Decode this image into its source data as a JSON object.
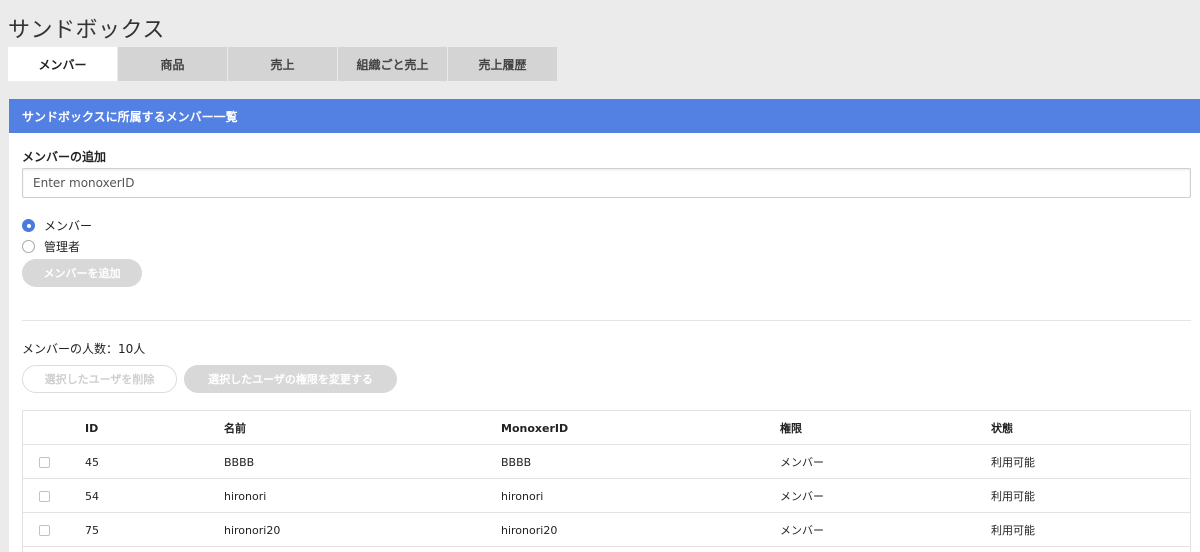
{
  "app": {
    "title": "サンドボックス"
  },
  "tabs": [
    {
      "label": "メンバー",
      "active": true
    },
    {
      "label": "商品",
      "active": false
    },
    {
      "label": "売上",
      "active": false
    },
    {
      "label": "組織ごと売上",
      "active": false
    },
    {
      "label": "売上履歴",
      "active": false
    }
  ],
  "panel": {
    "header": "サンドボックスに所属するメンバー一覧",
    "add_member": {
      "label": "メンバーの追加",
      "input_placeholder": "Enter monoxerID",
      "input_value": "",
      "roles": [
        {
          "label": "メンバー",
          "checked": true
        },
        {
          "label": "管理者",
          "checked": false
        }
      ],
      "add_button": "メンバーを追加"
    },
    "member_count": "メンバーの人数：10人",
    "actions": {
      "delete_selected": "選択したユーザを削除",
      "change_role": "選択したユーザの権限を変更する"
    },
    "table": {
      "columns": [
        "ID",
        "名前",
        "MonoxerID",
        "権限",
        "状態"
      ],
      "rows": [
        {
          "id": "45",
          "name": "BBBB",
          "monoxer_id": "BBBB",
          "role": "メンバー",
          "status": "利用可能"
        },
        {
          "id": "54",
          "name": "hironori",
          "monoxer_id": "hironori",
          "role": "メンバー",
          "status": "利用可能"
        },
        {
          "id": "75",
          "name": "hironori20",
          "monoxer_id": "hironori20",
          "role": "メンバー",
          "status": "利用可能"
        }
      ]
    }
  },
  "colors": {
    "accent": "#5380e3",
    "background": "#ebebeb",
    "disabled_button": "#d8d8d8"
  }
}
